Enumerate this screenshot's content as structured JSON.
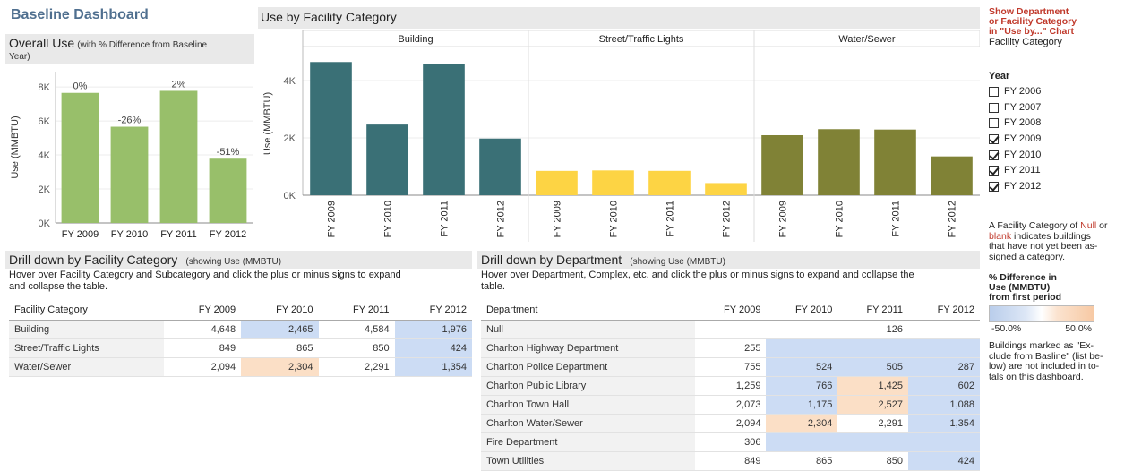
{
  "dashboard": {
    "title": "Baseline Dashboard"
  },
  "overall": {
    "title": "Overall Use",
    "subtitle_a": "(with % Difference from Baseline",
    "subtitle_b": "Year)",
    "ylabel": "Use (MMBTU)",
    "yticks": [
      "8K",
      "6K",
      "4K",
      "2K",
      "0K"
    ]
  },
  "facility_chart": {
    "title": "Use by Facility Category",
    "ylabel": "Use (MMBTU)",
    "yticks": [
      "4K",
      "2K",
      "0K"
    ],
    "panels": [
      "Building",
      "Street/Traffic Lights",
      "Water/Sewer"
    ],
    "x_labels": [
      "FY 2009",
      "FY 2010",
      "FY 2011",
      "FY 2012"
    ]
  },
  "drill_facility": {
    "title": "Drill down by Facility Category",
    "subtitle": "(showing Use (MMBTU)",
    "hint_a": "Hover over Facility Category and Subcategory and click the plus or minus signs to expand",
    "hint_b": "and collapse the table.",
    "headers": [
      "Facility Category",
      "FY 2009",
      "FY 2010",
      "FY 2011",
      "FY 2012"
    ],
    "rows": [
      {
        "name": "Building",
        "v": [
          "4,648",
          "2,465",
          "4,584",
          "1,976"
        ]
      },
      {
        "name": "Street/Traffic Lights",
        "v": [
          "849",
          "865",
          "850",
          "424"
        ]
      },
      {
        "name": "Water/Sewer",
        "v": [
          "2,094",
          "2,304",
          "2,291",
          "1,354"
        ]
      }
    ]
  },
  "drill_department": {
    "title": "Drill down by Department",
    "subtitle": "(showing Use (MMBTU)",
    "hint_a": "Hover over Department, Complex, etc. and click the plus or minus signs to expand and collapse the",
    "hint_b": "table.",
    "headers": [
      "Department",
      "FY 2009",
      "FY 2010",
      "FY 2011",
      "FY 2012"
    ],
    "rows": [
      {
        "name": "Null",
        "v": [
          "",
          "",
          "126",
          ""
        ]
      },
      {
        "name": "Charlton Highway Department",
        "v": [
          "255",
          "",
          "",
          ""
        ]
      },
      {
        "name": "Charlton Police Department",
        "v": [
          "755",
          "524",
          "505",
          "287"
        ]
      },
      {
        "name": "Charlton Public Library",
        "v": [
          "1,259",
          "766",
          "1,425",
          "602"
        ]
      },
      {
        "name": "Charlton Town Hall",
        "v": [
          "2,073",
          "1,175",
          "2,527",
          "1,088"
        ]
      },
      {
        "name": "Charlton Water/Sewer",
        "v": [
          "2,094",
          "2,304",
          "2,291",
          "1,354"
        ]
      },
      {
        "name": "Fire Department",
        "v": [
          "306",
          "",
          "",
          ""
        ]
      },
      {
        "name": "Town Utilities",
        "v": [
          "849",
          "865",
          "850",
          "424"
        ]
      }
    ]
  },
  "sidebar": {
    "show_title_1": "Show Department",
    "show_title_2": "or Facility Category",
    "show_title_3": "in \"Use by...\" Chart",
    "show_value": "Facility Category",
    "year_title": "Year",
    "years": [
      {
        "label": "FY 2006",
        "checked": false
      },
      {
        "label": "FY 2007",
        "checked": false
      },
      {
        "label": "FY 2008",
        "checked": false
      },
      {
        "label": "FY 2009",
        "checked": true
      },
      {
        "label": "FY 2010",
        "checked": true
      },
      {
        "label": "FY 2011",
        "checked": true
      },
      {
        "label": "FY 2012",
        "checked": true
      }
    ],
    "null_note_1": "A Facility Category of",
    "null_word": "Null",
    "null_or": "or",
    "blank_word": "blank",
    "null_note_2": "indicates buildings",
    "null_note_3": "that have not yet been as-",
    "null_note_4": "signed a category.",
    "legend_title_1": "% Difference in",
    "legend_title_2": "Use (MMBTU)",
    "legend_title_3": "from first period",
    "legend_min": "-50.0%",
    "legend_max": "50.0%",
    "excl_note_1": "Buildings marked as \"Ex-",
    "excl_note_2": "clude from Basline\" (list be-",
    "excl_note_3": "low) are not included in to-",
    "excl_note_4": "tals on this dashboard."
  },
  "colors": {
    "overall_bar": "#98bf6a",
    "building": "#3a7076",
    "street": "#fdd444",
    "water": "#808236",
    "neg_cell": "#ccdcf4",
    "pos_cell": "#fbdfc6",
    "accent_red": "#c0392b"
  },
  "chart_data": [
    {
      "type": "bar",
      "title": "Overall Use",
      "ylabel": "Use (MMBTU)",
      "categories": [
        "FY 2009",
        "FY 2010",
        "FY 2011",
        "FY 2012"
      ],
      "values": [
        7650,
        5660,
        7770,
        3780
      ],
      "data_labels": [
        "0%",
        "-26%",
        "2%",
        "-51%"
      ],
      "ylim": [
        0,
        8900
      ]
    },
    {
      "type": "bar",
      "title": "Use by Facility Category",
      "ylabel": "Use (MMBTU)",
      "categories": [
        "FY 2009",
        "FY 2010",
        "FY 2011",
        "FY 2012"
      ],
      "series": [
        {
          "name": "Building",
          "values": [
            4648,
            2465,
            4584,
            1976
          ]
        },
        {
          "name": "Street/Traffic Lights",
          "values": [
            849,
            865,
            850,
            424
          ]
        },
        {
          "name": "Water/Sewer",
          "values": [
            2094,
            2304,
            2291,
            1354
          ]
        }
      ],
      "ylim": [
        0,
        5000
      ]
    }
  ]
}
